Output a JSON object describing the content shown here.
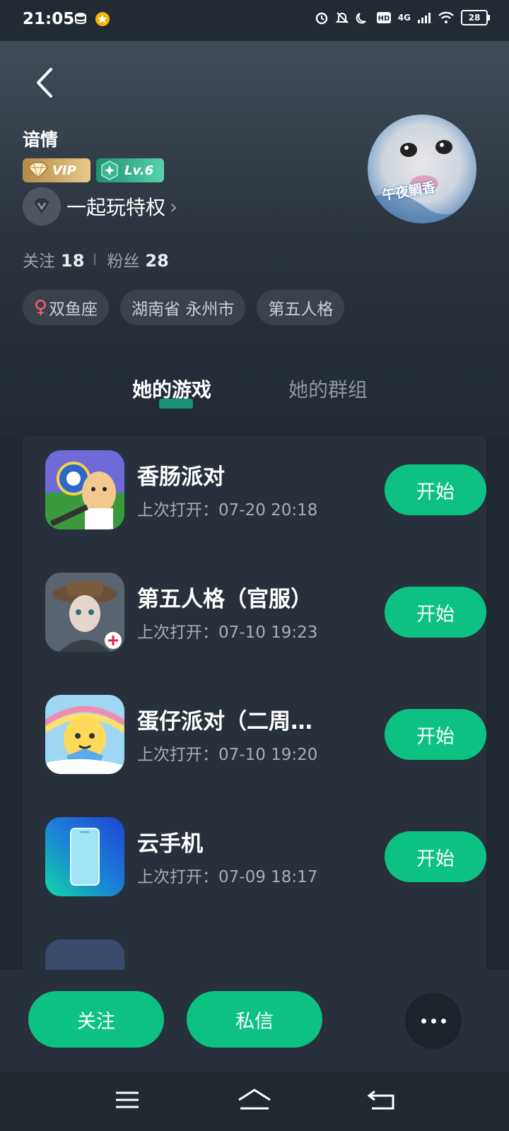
{
  "status_bar": {
    "time": "21:05",
    "network": "4G",
    "battery": "28",
    "icons": [
      "database-icon",
      "star-badge-icon",
      "alarm-icon",
      "bell-off-icon",
      "moon-icon",
      "hd-icon",
      "signal-icon",
      "wifi-icon",
      "battery-icon"
    ]
  },
  "profile": {
    "name": "谙情",
    "vip_label": "VIP",
    "level_label": "Lv.6",
    "privilege_label": "一起玩特权",
    "avatar_text": "午夜鲷香",
    "stats": {
      "following_label": "关注",
      "following_count": "18",
      "fans_label": "粉丝",
      "fans_count": "28"
    },
    "tags": [
      "双鱼座",
      "湖南省 永州市",
      "第五人格"
    ]
  },
  "tabs": {
    "active": "她的游戏",
    "other": "她的群组"
  },
  "games": [
    {
      "name": "香肠派对",
      "last_open": "上次打开：07-20 20:18",
      "button": "开始"
    },
    {
      "name": "第五人格（官服）",
      "last_open": "上次打开：07-10 19:23",
      "button": "开始"
    },
    {
      "name": "蛋仔派对（二周…",
      "last_open": "上次打开：07-10 19:20",
      "button": "开始"
    },
    {
      "name": "云手机",
      "last_open": "上次打开：07-09 18:17",
      "button": "开始"
    }
  ],
  "actions": {
    "follow": "关注",
    "message": "私信"
  },
  "colors": {
    "accent": "#0dc183",
    "background": "#1f2731",
    "card": "#28313b"
  }
}
